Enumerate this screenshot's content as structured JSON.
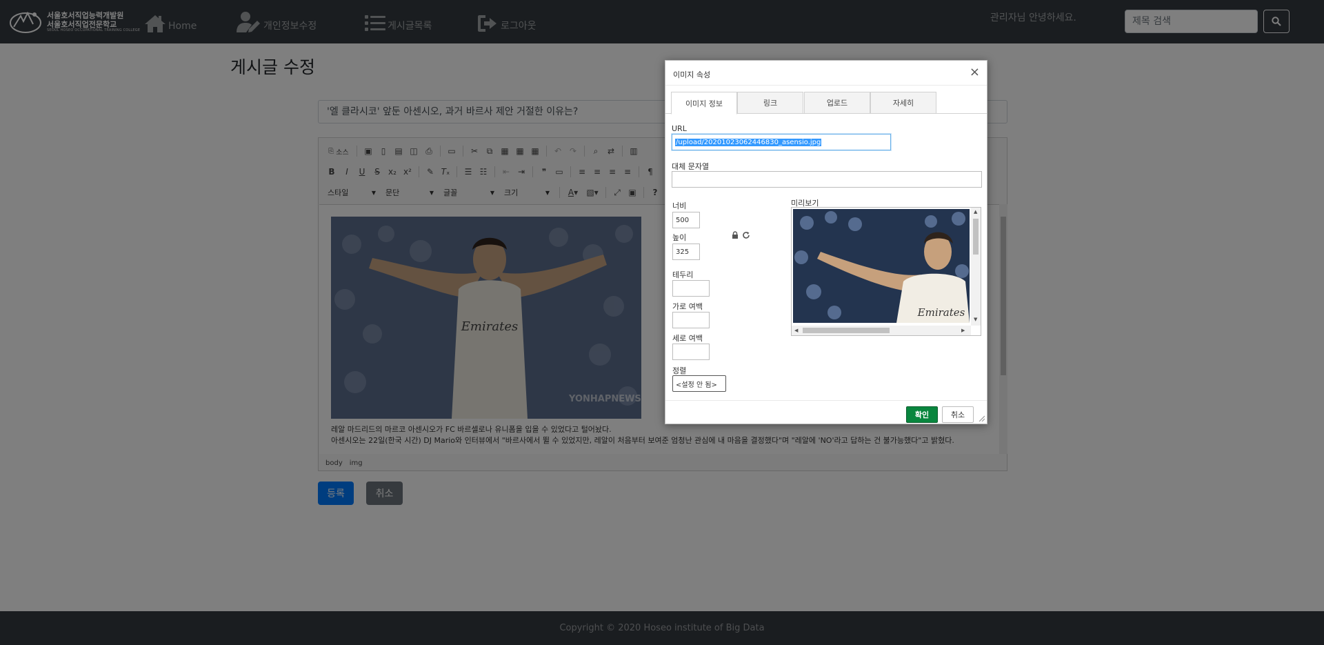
{
  "navbar": {
    "logo_line1": "서울호서직업능력개발원",
    "logo_line2": "서울호서직업전문학교",
    "logo_line3": "SEOUL HOSEO OCCUPATIONAL TRAINING COLLEGE",
    "links": [
      {
        "label": "Home",
        "icon": "home-icon"
      },
      {
        "label": "개인정보수정",
        "icon": "user-edit-icon"
      },
      {
        "label": "게시글목록",
        "icon": "list-icon"
      },
      {
        "label": "로그아웃",
        "icon": "sign-out-icon"
      }
    ],
    "greeting": "관리자님 안녕하세요.",
    "search_placeholder": "제목 검색"
  },
  "page": {
    "title": "게시글 수정",
    "post_title": "'엘 클라시코' 앞둔 아센시오, 과거 바르사 제안 거절한 이유는?",
    "submit_label": "등록",
    "cancel_label": "취소"
  },
  "editor": {
    "source_label": "소스",
    "combos": [
      "스타일",
      "문단",
      "글꼴",
      "크기"
    ],
    "content_lines": [
      "레알 마드리드의 마르코 아센시오가 FC 바르셀로나 유니폼을 입을 수 있었다고 털어놨다.",
      "아센시오는 22일(한국 시간) DJ Mario와 인터뷰에서 \"바르사에서 뛸 수 있었지만, 레알이 처음부터 보여준 엄청난 관심에 내 마음을 결정했다\"며 \"레알에 'NO'라고 답하는 건 불가능했다\"고 밝혔다."
    ],
    "image_watermark": "YONHAPNEWS",
    "status_path": [
      "body",
      "img"
    ]
  },
  "dialog": {
    "title": "이미지 속성",
    "close_label": "×",
    "tabs": [
      "이미지 정보",
      "링크",
      "업로드",
      "자세히"
    ],
    "active_tab": 0,
    "url_label": "URL",
    "url_value": "/upload/20201023062446830_asensio.jpg",
    "alt_label": "대체 문자열",
    "alt_value": "",
    "width_label": "너비",
    "width_value": "500",
    "height_label": "높이",
    "height_value": "325",
    "border_label": "테두리",
    "hspace_label": "가로 여백",
    "vspace_label": "세로 여백",
    "align_label": "정렬",
    "align_value": "<설정 안 됨>",
    "preview_label": "미리보기",
    "ok_label": "확인",
    "cancel_label": "취소"
  },
  "footer": {
    "text": "Copyright © 2020 Hoseo institute of Big Data"
  },
  "colors": {
    "navbar": "#343a40",
    "primary": "#007bff",
    "secondary": "#6c757d",
    "ok": "#09863e",
    "overlay": "rgba(0,0,0,0.5)"
  }
}
